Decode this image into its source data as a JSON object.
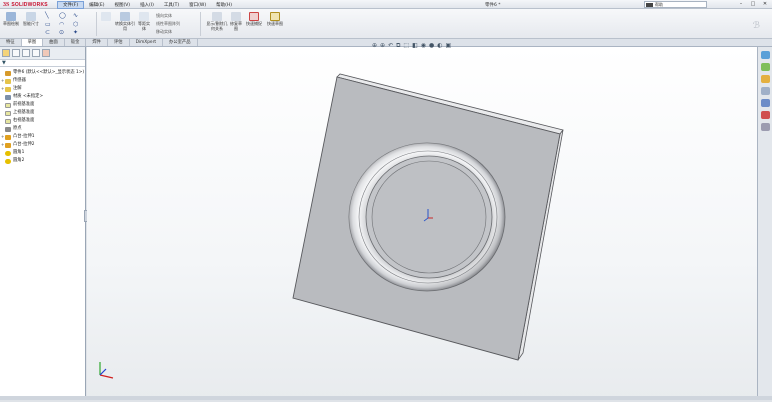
{
  "app": {
    "brand_ds": "3S",
    "brand_name": "SOLIDWORKS",
    "doc_title": "零件6 *",
    "search_text": "帮助"
  },
  "menu": [
    {
      "label": "文件(F)"
    },
    {
      "label": "编辑(E)"
    },
    {
      "label": "视图(V)"
    },
    {
      "label": "插入(I)"
    },
    {
      "label": "工具(T)"
    },
    {
      "label": "窗口(W)"
    },
    {
      "label": "帮助(H)"
    }
  ],
  "ribbon": {
    "sketch_label": "草图绘制",
    "smart_dim_label": "智能尺寸",
    "entity_label": "实体",
    "convert_label": "转换实体引用",
    "offset_label": "等距实体",
    "mirror_label": "镜向实体",
    "linear_pattern_label": "线性草图阵列",
    "move_label": "移动实体",
    "display_delete_label": "显示/删除几何关系",
    "repair_label": "修复草图",
    "quick_snap_label": "快速捕捉",
    "rapid_sketch_label": "快速草图"
  },
  "tabs": [
    {
      "label": "特征"
    },
    {
      "label": "草图"
    },
    {
      "label": "曲面"
    },
    {
      "label": "钣金"
    },
    {
      "label": "焊件"
    },
    {
      "label": "评估"
    },
    {
      "label": "DimXpert"
    },
    {
      "label": "办公室产品"
    }
  ],
  "tree": [
    {
      "label": "零件6 (默认<<默认>_显示状态 1>)",
      "icon_color": "#d79a2b"
    },
    {
      "label": "传感器",
      "icon_color": "#e5c34a"
    },
    {
      "label": "注解",
      "icon_color": "#e5c34a"
    },
    {
      "label": "材质 <未指定>",
      "icon_color": "#7c8fa8"
    },
    {
      "label": "前视基准面",
      "icon_color": "#e6e6a0"
    },
    {
      "label": "上视基准面",
      "icon_color": "#e6e6a0"
    },
    {
      "label": "右视基准面",
      "icon_color": "#e6e6a0"
    },
    {
      "label": "原点",
      "icon_color": "#8a8a8a"
    },
    {
      "label": "凸台-拉伸1",
      "icon_color": "#e0a020"
    },
    {
      "label": "凸台-拉伸2",
      "icon_color": "#e0a020"
    },
    {
      "label": "圆角1",
      "icon_color": "#e6c000"
    },
    {
      "label": "圆角2",
      "icon_color": "#e6c000"
    }
  ],
  "filter_icon": "filter-icon",
  "colors": {
    "part_face": "#b9bbbf",
    "part_edge": "#58595d",
    "accent": "#c8102e"
  }
}
